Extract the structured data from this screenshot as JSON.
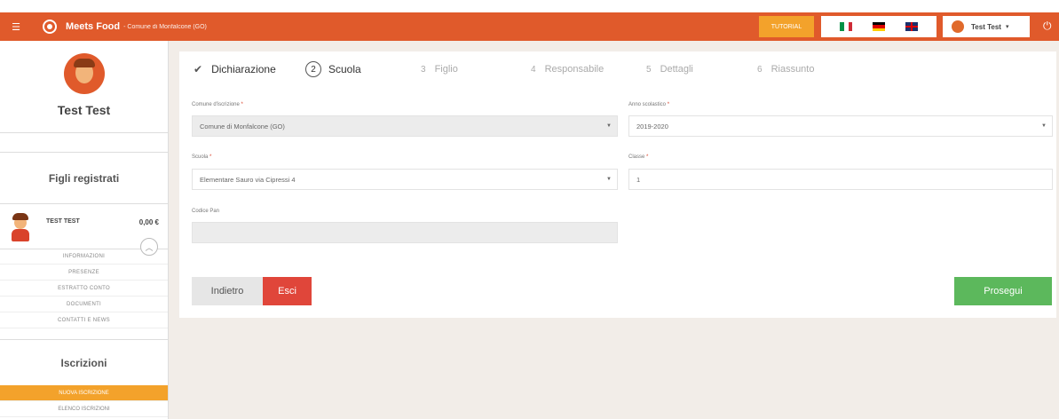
{
  "topbar": {
    "menu_icon": "menu-icon",
    "brand_name": "Meets Food",
    "brand_sub": "- Comune di Monfalcone (GO)",
    "tutorial_label": "TUTORIAL",
    "user_name": "Test Test",
    "user_caret": "▾",
    "power_icon": "power-icon",
    "accent_color": "#e05a2b"
  },
  "sidebar": {
    "profile_name": "Test Test",
    "children_title": "Figli registrati",
    "child": {
      "name": "TEST TEST",
      "balance": "0,00 €"
    },
    "child_menu": [
      "INFORMAZIONI",
      "PRESENZE",
      "ESTRATTO CONTO",
      "DOCUMENTI",
      "CONTATTI E NEWS"
    ],
    "iscrizioni_title": "Iscrizioni",
    "iscrizioni_menu": [
      "NUOVA ISCRIZIONE",
      "ELENCO ISCRIZIONI"
    ]
  },
  "steps": [
    {
      "num": "",
      "label": "Dichiarazione"
    },
    {
      "num": "2",
      "label": "Scuola"
    },
    {
      "num": "3",
      "label": "Figlio"
    },
    {
      "num": "4",
      "label": "Responsabile"
    },
    {
      "num": "5",
      "label": "Dettagli"
    },
    {
      "num": "6",
      "label": "Riassunto"
    }
  ],
  "form": {
    "comune_label": "Comune d'iscrizione",
    "comune_value": "Comune di Monfalcone (GO)",
    "anno_label": "Anno scolastico",
    "anno_value": "2019-2020",
    "scuola_label": "Scuola",
    "scuola_value": "Elementare Sauro via Cipressi 4",
    "classe_label": "Classe",
    "classe_value": "1",
    "codice_label": "Codice Pan",
    "codice_value": "",
    "required_mark": "*"
  },
  "buttons": {
    "back": "Indietro",
    "exit": "Esci",
    "next": "Prosegui"
  }
}
